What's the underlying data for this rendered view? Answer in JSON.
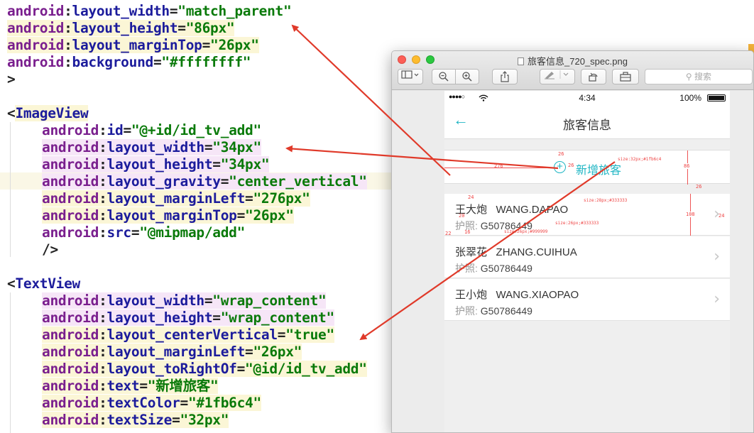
{
  "editor": {
    "block1": {
      "width": {
        "ns": "android",
        "attr": "layout_width",
        "value": "\"match_parent\""
      },
      "height": {
        "ns": "android",
        "attr": "layout_height",
        "value": "\"86px\""
      },
      "marginTop": {
        "ns": "android",
        "attr": "layout_marginTop",
        "value": "\"26px\""
      },
      "background": {
        "ns": "android",
        "attr": "background",
        "value": "\"#ffffffff\""
      },
      "close": ">"
    },
    "imageview": {
      "open": "<",
      "tag": "ImageView",
      "id": {
        "ns": "android",
        "attr": "id",
        "value": "\"@+id/id_tv_add\""
      },
      "width": {
        "ns": "android",
        "attr": "layout_width",
        "value": "\"34px\""
      },
      "height": {
        "ns": "android",
        "attr": "layout_height",
        "value": "\"34px\""
      },
      "gravity": {
        "ns": "android",
        "attr": "layout_gravity",
        "value": "\"center_vertical\""
      },
      "marginLeft": {
        "ns": "android",
        "attr": "layout_marginLeft",
        "value": "\"276px\""
      },
      "marginTop": {
        "ns": "android",
        "attr": "layout_marginTop",
        "value": "\"26px\""
      },
      "src": {
        "ns": "android",
        "attr": "src",
        "value": "\"@mipmap/add\""
      },
      "close": "/>"
    },
    "textview": {
      "open": "<",
      "tag": "TextView",
      "width": {
        "ns": "android",
        "attr": "layout_width",
        "value": "\"wrap_content\""
      },
      "height": {
        "ns": "android",
        "attr": "layout_height",
        "value": "\"wrap_content\""
      },
      "centerVertical": {
        "ns": "android",
        "attr": "layout_centerVertical",
        "value": "\"true\""
      },
      "marginLeft": {
        "ns": "android",
        "attr": "layout_marginLeft",
        "value": "\"26px\""
      },
      "toRightOf": {
        "ns": "android",
        "attr": "layout_toRightOf",
        "value": "\"@id/id_tv_add\""
      },
      "text": {
        "ns": "android",
        "attr": "text",
        "value": "\"新增旅客\""
      },
      "textColor": {
        "ns": "android",
        "attr": "textColor",
        "value": "\"#1fb6c4\""
      },
      "textSize": {
        "ns": "android",
        "attr": "textSize",
        "value": "\"32px\""
      }
    }
  },
  "preview_window": {
    "title": "旅客信息_720_spec.png",
    "search_placeholder": "搜索",
    "toolbar_icons": [
      "sidebar-icon",
      "zoom-out-icon",
      "zoom-in-icon",
      "share-icon",
      "markup-icon",
      "rotate-icon",
      "toolbox-icon"
    ]
  },
  "phone": {
    "status": {
      "signal": "●●●●○",
      "time": "4:34",
      "battery": "100%"
    },
    "back_symbol": "←",
    "screen_title": "旅客信息",
    "add_icon": "+",
    "add_label": "新增旅客",
    "passport_label": "护照:",
    "passengers": [
      {
        "name": "王大炮",
        "pinyin": "WANG.DAPAO",
        "passport": "G50786449"
      },
      {
        "name": "张翠花",
        "pinyin": "ZHANG.CUIHUA",
        "passport": "G50786449"
      },
      {
        "name": "王小炮",
        "pinyin": "WANG.XIAOPAO",
        "passport": "G50786449"
      }
    ],
    "spec_annotations": {
      "add_top": "26",
      "add_left": "276",
      "add_gap": "26",
      "add_text_spec": "size:32px;#1fb6c4",
      "add_height": "86",
      "section_gap": "26",
      "row_top": "24",
      "row_mid": "20",
      "row_bottom": "16",
      "row_left": "22",
      "row_height": "108",
      "row_right": "24",
      "name_spec": "size:28px;#333333",
      "id_spec": "size:26px;#333333",
      "label_spec": "size:26px;#999999"
    }
  },
  "colors": {
    "accent": "#1fb6c4",
    "arrow": "#e03a2a"
  }
}
